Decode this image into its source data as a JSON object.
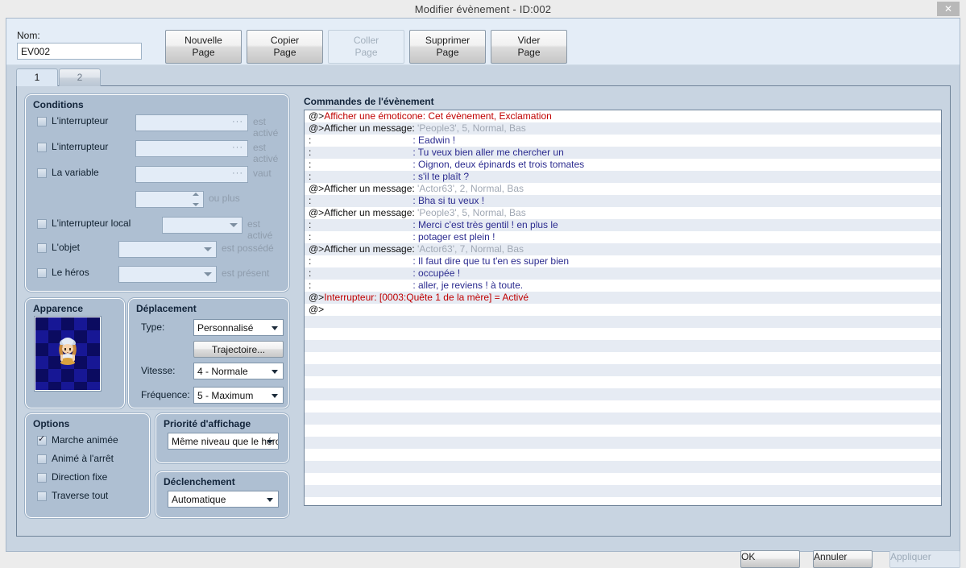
{
  "window": {
    "title": "Modifier évènement - ID:002",
    "close_icon": "close-icon",
    "close_glyph": "✕"
  },
  "header": {
    "nom_label": "Nom:",
    "nom_value": "EV002",
    "nom_placeholder": "",
    "buttons": [
      {
        "id": "nouvelle",
        "label": "Nouvelle\nPage",
        "enabled": true
      },
      {
        "id": "copier",
        "label": "Copier\nPage",
        "enabled": true
      },
      {
        "id": "coller",
        "label": "Coller\nPage",
        "enabled": false
      },
      {
        "id": "supprimer",
        "label": "Supprimer\nPage",
        "enabled": true
      },
      {
        "id": "vider",
        "label": "Vider\nPage",
        "enabled": true
      }
    ]
  },
  "tabs": [
    {
      "label": "1",
      "active": true
    },
    {
      "label": "2",
      "active": false
    }
  ],
  "conditions": {
    "legend": "Conditions",
    "rows": [
      {
        "label": "L'interrupteur",
        "checked": false,
        "field": "",
        "field_kind": "picker",
        "suffix": "est activé"
      },
      {
        "label": "L'interrupteur",
        "checked": false,
        "field": "",
        "field_kind": "picker",
        "suffix": "est activé"
      },
      {
        "label": "La variable",
        "checked": false,
        "field": "",
        "field_kind": "picker",
        "suffix": "vaut"
      },
      {
        "label": "",
        "checked": null,
        "field": "",
        "field_kind": "spinner",
        "suffix": "ou plus"
      },
      {
        "label": "L'interrupteur local",
        "checked": false,
        "field": "",
        "field_kind": "combo",
        "suffix": "est activé"
      },
      {
        "label": "L'objet",
        "checked": false,
        "field": "",
        "field_kind": "combo",
        "suffix": "est possédé"
      },
      {
        "label": "Le héros",
        "checked": false,
        "field": "",
        "field_kind": "combo",
        "suffix": "est présent"
      }
    ]
  },
  "apparence": {
    "legend": "Apparence",
    "sprite_name": "character-sprite-preview"
  },
  "deplacement": {
    "legend": "Déplacement",
    "type_label": "Type:",
    "type_value": "Personnalisé",
    "trajectoire_label": "Trajectoire...",
    "vitesse_label": "Vitesse:",
    "vitesse_value": "4 - Normale",
    "frequence_label": "Fréquence:",
    "frequence_value": "5 - Maximum"
  },
  "options": {
    "legend": "Options",
    "items": [
      {
        "label": "Marche animée",
        "checked": true
      },
      {
        "label": "Animé à l'arrêt",
        "checked": false
      },
      {
        "label": "Direction fixe",
        "checked": false
      },
      {
        "label": "Traverse tout",
        "checked": false
      }
    ]
  },
  "priorite": {
    "legend": "Priorité d'affichage",
    "value": "Même niveau que le héros"
  },
  "declenchement": {
    "legend": "Déclenchement",
    "value": "Automatique"
  },
  "commands": {
    "legend": "Commandes de l'évènement",
    "rows": [
      {
        "prefix": "@>",
        "prefix_color": "blk",
        "text": "Afficher une émoticone: Cet évènement, Exclamation",
        "color": "red",
        "indent": 0
      },
      {
        "prefix": "@>",
        "prefix_color": "blk",
        "text": "Afficher un message: ",
        "color": "blk",
        "arg": "'People3', 5, Normal, Bas",
        "arg_color": "gry",
        "indent": 0
      },
      {
        "prefix": ":",
        "prefix_color": "blk",
        "text": ": Eadwin !",
        "color": "blue",
        "indent": 1
      },
      {
        "prefix": ":",
        "prefix_color": "blk",
        "text": ": Tu veux bien aller me chercher un",
        "color": "blue",
        "indent": 1
      },
      {
        "prefix": ":",
        "prefix_color": "blk",
        "text": ": Oignon, deux épinards et trois tomates",
        "color": "blue",
        "indent": 1
      },
      {
        "prefix": ":",
        "prefix_color": "blk",
        "text": ": s'il te plaît ?",
        "color": "blue",
        "indent": 1
      },
      {
        "prefix": "@>",
        "prefix_color": "blk",
        "text": "Afficher un message: ",
        "color": "blk",
        "arg": "'Actor63', 2, Normal, Bas",
        "arg_color": "gry",
        "indent": 0
      },
      {
        "prefix": ":",
        "prefix_color": "blk",
        "text": ": Bha si tu veux !",
        "color": "blue",
        "indent": 1
      },
      {
        "prefix": "@>",
        "prefix_color": "blk",
        "text": "Afficher un message: ",
        "color": "blk",
        "arg": "'People3', 5, Normal, Bas",
        "arg_color": "gry",
        "indent": 0
      },
      {
        "prefix": ":",
        "prefix_color": "blk",
        "text": ": Merci c'est très gentil ! en plus le",
        "color": "blue",
        "indent": 1
      },
      {
        "prefix": ":",
        "prefix_color": "blk",
        "text": ": potager est plein !",
        "color": "blue",
        "indent": 1
      },
      {
        "prefix": "@>",
        "prefix_color": "blk",
        "text": "Afficher un message: ",
        "color": "blk",
        "arg": "'Actor63', 7, Normal, Bas",
        "arg_color": "gry",
        "indent": 0
      },
      {
        "prefix": ":",
        "prefix_color": "blk",
        "text": ": Il faut dire que tu t'en es super bien",
        "color": "blue",
        "indent": 1
      },
      {
        "prefix": ":",
        "prefix_color": "blk",
        "text": ": occupée !",
        "color": "blue",
        "indent": 1
      },
      {
        "prefix": ":",
        "prefix_color": "blk",
        "text": ": aller, je reviens ! à toute.",
        "color": "blue",
        "indent": 1
      },
      {
        "prefix": "@>",
        "prefix_color": "blk",
        "text": "Interrupteur: [0003:Quête 1 de la mère] = Activé",
        "color": "red",
        "indent": 0
      },
      {
        "prefix": "@>",
        "prefix_color": "blk",
        "text": "",
        "color": "blk",
        "indent": 0
      }
    ],
    "empty_rows": 16
  },
  "footer": {
    "buttons": [
      {
        "id": "ok",
        "label": "OK",
        "enabled": true
      },
      {
        "id": "annuler",
        "label": "Annuler",
        "enabled": true
      },
      {
        "id": "appliquer",
        "label": "Appliquer",
        "enabled": false
      }
    ]
  },
  "colors": {
    "window_bg": "#ececec",
    "dialog_bg": "#c8d4e1",
    "header_strip": "#e4edf7",
    "group_bg": "#aebfd2",
    "list_bg": "#ffffff",
    "list_alt": "#e6ebf3",
    "cmd_red": "#c00000",
    "cmd_blue": "#2b2b8f",
    "cmd_gray": "#a0a8b4",
    "sprite_bg": "#0b0b60"
  }
}
